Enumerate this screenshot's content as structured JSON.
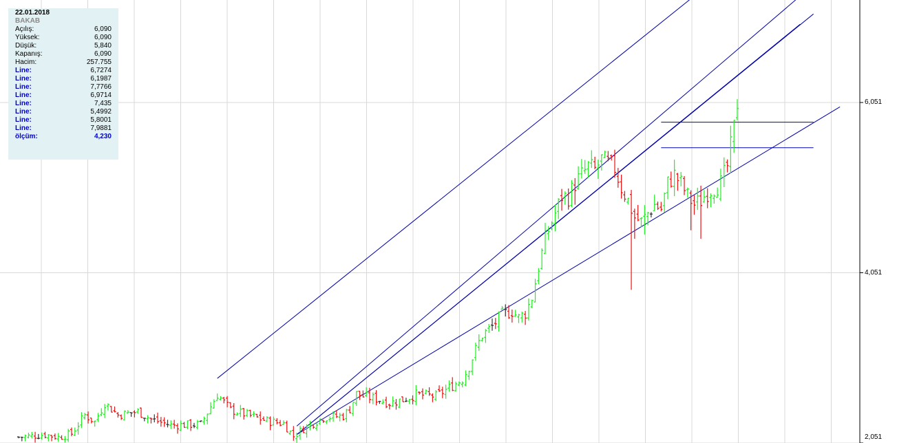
{
  "info_panel": {
    "date": "22.01.2018",
    "symbol": "BAKAB",
    "rows": [
      {
        "label": "Açılış:",
        "value": "6,090",
        "style": "normal"
      },
      {
        "label": "Yüksek:",
        "value": "6,090",
        "style": "normal"
      },
      {
        "label": "Düşük:",
        "value": "5,840",
        "style": "normal"
      },
      {
        "label": "Kapanış:",
        "value": "6,090",
        "style": "normal"
      },
      {
        "label": "Hacim:",
        "value": "257.755",
        "style": "normal"
      },
      {
        "label": "Line:",
        "value": "6,7274",
        "style": "line"
      },
      {
        "label": "Line:",
        "value": "6,1987",
        "style": "line"
      },
      {
        "label": "Line:",
        "value": "7,7766",
        "style": "line"
      },
      {
        "label": "Line:",
        "value": "6,9714",
        "style": "line"
      },
      {
        "label": "Line:",
        "value": "7,435",
        "style": "line"
      },
      {
        "label": "Line:",
        "value": "5,4992",
        "style": "line"
      },
      {
        "label": "Line:",
        "value": "5,8001",
        "style": "line"
      },
      {
        "label": "Line:",
        "value": "7,9881",
        "style": "line"
      },
      {
        "label": "ölçüm:",
        "value": "4,230",
        "style": "measure"
      }
    ]
  },
  "price_axis": {
    "ticks": [
      {
        "value": 6.051,
        "label": "6,051"
      },
      {
        "value": 4.051,
        "label": "4,051"
      },
      {
        "value": 2.051,
        "label": "2,051"
      }
    ]
  },
  "colors": {
    "up": "#22ee22",
    "down": "#ee1111",
    "neutral": "#333333",
    "trendline": "#0000aa",
    "grid": "#d8d8d8"
  },
  "chart_data": {
    "type": "candlestick",
    "ylim": [
      2.051,
      6.051
    ],
    "grid": true,
    "last_bar": {
      "open": 6.09,
      "high": 6.09,
      "low": 5.84,
      "close": 6.09,
      "volume": 257755
    },
    "price_path": [
      [
        0,
        2.12
      ],
      [
        8,
        2.15
      ],
      [
        12,
        2.12
      ],
      [
        16,
        2.16
      ],
      [
        20,
        2.38
      ],
      [
        23,
        2.3
      ],
      [
        26,
        2.52
      ],
      [
        30,
        2.38
      ],
      [
        36,
        2.42
      ],
      [
        40,
        2.33
      ],
      [
        46,
        2.26
      ],
      [
        55,
        2.27
      ],
      [
        60,
        2.62
      ],
      [
        64,
        2.44
      ],
      [
        70,
        2.37
      ],
      [
        75,
        2.31
      ],
      [
        80,
        2.28
      ],
      [
        83,
        2.13
      ],
      [
        86,
        2.22
      ],
      [
        92,
        2.35
      ],
      [
        98,
        2.37
      ],
      [
        100,
        2.45
      ],
      [
        102,
        2.63
      ],
      [
        104,
        2.6
      ],
      [
        108,
        2.57
      ],
      [
        112,
        2.52
      ],
      [
        116,
        2.56
      ],
      [
        120,
        2.62
      ],
      [
        126,
        2.6
      ],
      [
        130,
        2.7
      ],
      [
        134,
        2.8
      ],
      [
        136,
        2.95
      ],
      [
        138,
        3.15
      ],
      [
        140,
        3.32
      ],
      [
        143,
        3.42
      ],
      [
        146,
        3.56
      ],
      [
        149,
        3.6
      ],
      [
        151,
        3.52
      ],
      [
        153,
        3.58
      ],
      [
        155,
        3.76
      ],
      [
        157,
        4.12
      ],
      [
        159,
        4.45
      ],
      [
        162,
        4.75
      ],
      [
        164,
        4.95
      ],
      [
        166,
        4.94
      ],
      [
        168,
        5.1
      ],
      [
        170,
        5.2
      ],
      [
        172,
        5.3
      ],
      [
        174,
        5.26
      ],
      [
        176,
        5.38
      ],
      [
        178,
        5.33
      ],
      [
        180,
        5.28
      ],
      [
        182,
        5.05
      ],
      [
        184,
        4.9
      ],
      [
        186,
        4.7
      ],
      [
        188,
        4.65
      ],
      [
        190,
        4.75
      ],
      [
        192,
        4.85
      ],
      [
        194,
        4.8
      ],
      [
        196,
        5.1
      ],
      [
        198,
        5.2
      ],
      [
        200,
        5.1
      ],
      [
        202,
        4.95
      ],
      [
        204,
        4.85
      ],
      [
        206,
        4.9
      ],
      [
        208,
        5.0
      ],
      [
        210,
        5.05
      ],
      [
        212,
        5.1
      ],
      [
        214,
        5.3
      ],
      [
        216,
        5.75
      ],
      [
        217,
        6.05
      ]
    ],
    "trendlines": [
      {
        "x": [
          60,
          226
        ],
        "y": [
          2.81,
          7.988
        ]
      },
      {
        "x": [
          84,
          236
        ],
        "y": [
          2.15,
          6.971
        ]
      },
      {
        "x": [
          84,
          240
        ],
        "y": [
          2.25,
          7.435
        ]
      },
      {
        "x": [
          84,
          240
        ],
        "y": [
          2.15,
          7.091
        ]
      },
      {
        "x": [
          84,
          248
        ],
        "y": [
          2.15,
          6.0
        ]
      },
      {
        "x": [
          194,
          240
        ],
        "y": [
          5.82,
          5.82
        ]
      },
      {
        "x": [
          194,
          240
        ],
        "y": [
          5.52,
          5.52
        ]
      }
    ]
  }
}
